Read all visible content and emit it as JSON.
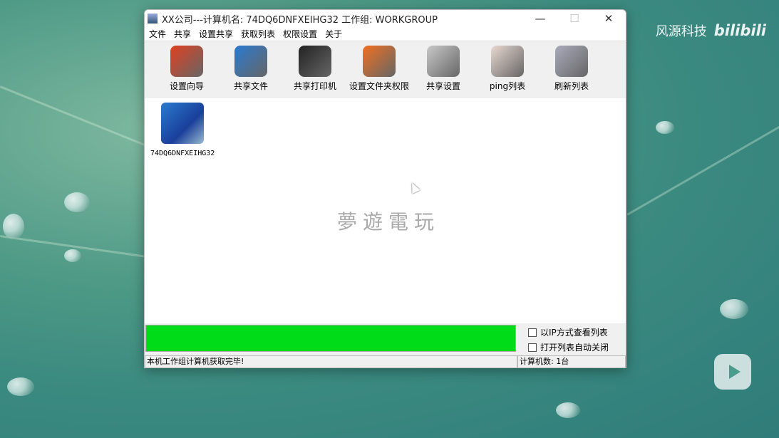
{
  "watermark": {
    "brand": "风源科技",
    "site": "bilibili",
    "center": "夢遊電玩"
  },
  "window": {
    "title": "XX公司---计算机名: 74DQ6DNFXEIHG32  工作组: WORKGROUP",
    "minimize": "—",
    "maximize": "☐",
    "close": "✕"
  },
  "menu": [
    "文件",
    "共享",
    "设置共享",
    "获取列表",
    "权限设置",
    "关于"
  ],
  "toolbar": [
    {
      "label": "设置向导",
      "icon": "windows-logo-icon",
      "color": "#e04020"
    },
    {
      "label": "共享文件",
      "icon": "globe-icon",
      "color": "#2a7ad0"
    },
    {
      "label": "共享打印机",
      "icon": "printer-icon",
      "color": "#222222"
    },
    {
      "label": "设置文件夹权限",
      "icon": "folder-icon",
      "color": "#f07020"
    },
    {
      "label": "共享设置",
      "icon": "tools-icon",
      "color": "#c8c8c8"
    },
    {
      "label": "ping列表",
      "icon": "magnifier-icon",
      "color": "#e8d8d0"
    },
    {
      "label": "刷新列表",
      "icon": "refresh-icon",
      "color": "#aab"
    }
  ],
  "computers": [
    {
      "name": "74DQ6DNFXEIHG32"
    }
  ],
  "progress": {
    "percent": 100,
    "color": "#00dc18"
  },
  "options": [
    {
      "label": "以IP方式查看列表",
      "checked": false
    },
    {
      "label": "打开列表自动关闭",
      "checked": false
    }
  ],
  "status": {
    "message": "本机工作组计算机获取完毕!",
    "count": "计算机数: 1台"
  }
}
